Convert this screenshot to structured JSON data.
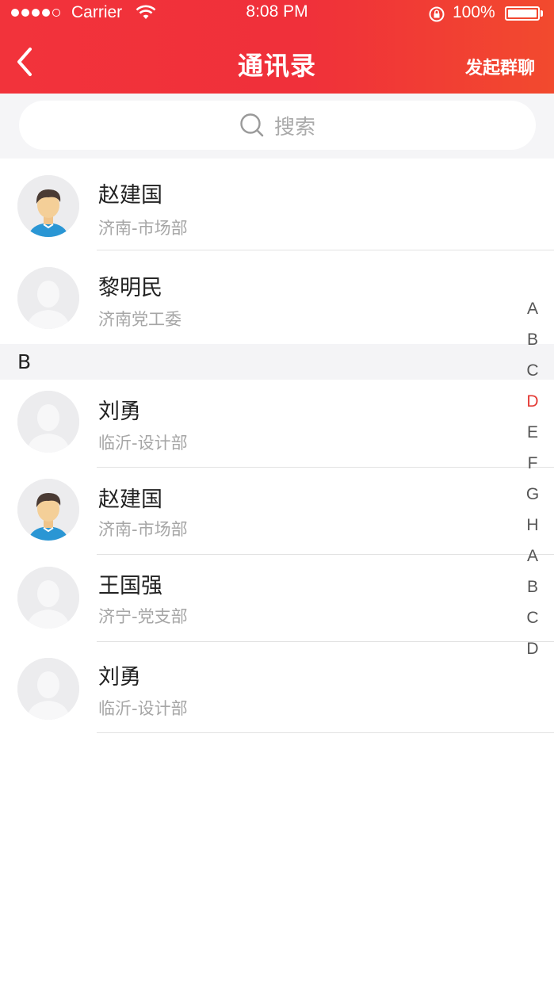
{
  "status_bar": {
    "carrier": "Carrier",
    "time": "8:08 PM",
    "battery": "100%",
    "signal_bars": 4
  },
  "nav": {
    "back_icon": "chevron-left-icon",
    "title": "通讯录",
    "action": "发起群聊"
  },
  "search": {
    "placeholder": "搜索",
    "icon": "search-icon"
  },
  "contacts_top": [
    {
      "name": "赵建国",
      "dept": "济南-市场部",
      "avatar": "male-avatar"
    },
    {
      "name": "黎明民",
      "dept": "济南党工委",
      "avatar": "placeholder-avatar"
    }
  ],
  "section_b": {
    "letter": "B",
    "contacts": [
      {
        "name": "刘勇",
        "dept": "临沂-设计部",
        "avatar": "placeholder-avatar"
      },
      {
        "name": "赵建国",
        "dept": "济南-市场部",
        "avatar": "male-avatar"
      },
      {
        "name": "王国强",
        "dept": "济宁-党支部",
        "avatar": "placeholder-avatar"
      },
      {
        "name": "刘勇",
        "dept": "临沂-设计部",
        "avatar": "placeholder-avatar"
      }
    ]
  },
  "index_letters": [
    "A",
    "B",
    "C",
    "D",
    "E",
    "F",
    "G",
    "H",
    "A",
    "B",
    "C",
    "D"
  ],
  "active_index": "D",
  "colors": {
    "header_red": "#f0303a",
    "active_index": "#e43a34",
    "avatar_shirt": "#2a96d4"
  }
}
